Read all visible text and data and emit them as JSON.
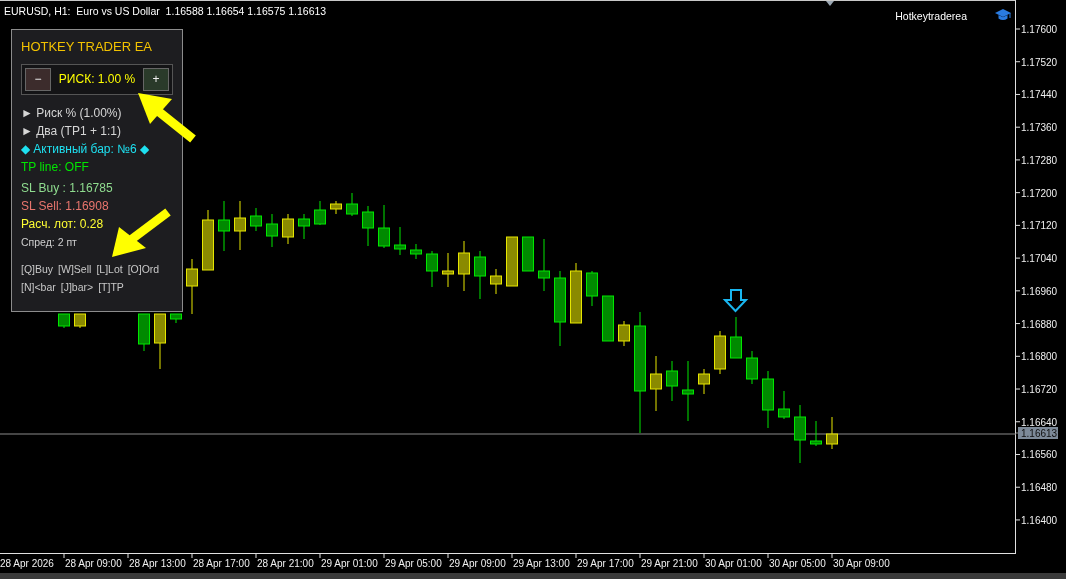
{
  "header": "EURUSD, H1:  Euro vs US Dollar  1.16588 1.16654 1.16575 1.16613",
  "chart_label": "Hotkeytraderea",
  "panel": {
    "title": "HOTKEY TRADER EA",
    "minus": "−",
    "risk": "РИСК: 1.00 %",
    "plus": "+",
    "lines": [
      {
        "text": "► Риск % (1.00%)",
        "color": "#d6d6d6"
      },
      {
        "text": "► Два (TP1 + 1:1)",
        "color": "#d6d6d6"
      },
      {
        "text": "◆ Активный бар: №6 ◆",
        "color": "#1ee0f0"
      },
      {
        "text": "TP line: OFF",
        "color": "#00e600"
      },
      {
        "text": "SL Buy : 1.16785",
        "color": "#8fdc8f"
      },
      {
        "text": "SL Sell: 1.16908",
        "color": "#e8756d"
      },
      {
        "text": "Расч. лот: 0.28",
        "color": "#ffff33"
      }
    ],
    "spread": "Спред: 2 пт",
    "hotkeys": [
      [
        "[Q]Buy",
        "[W]Sell",
        "[L]Lot",
        "[O]Ord"
      ],
      [
        "[N]<bar",
        "[J]bar>",
        "[T]TP"
      ]
    ]
  },
  "price_axis": [
    "1.17600",
    "1.17520",
    "1.17440",
    "1.17360",
    "1.17280",
    "1.17200",
    "1.17120",
    "1.17040",
    "1.16960",
    "1.16880",
    "1.16800",
    "1.16720",
    "1.16640",
    "1.16560",
    "1.16480",
    "1.16400"
  ],
  "current_price": "1.16613",
  "time_axis": [
    "28 Apr 2026",
    "28 Apr 09:00",
    "28 Apr 13:00",
    "28 Apr 17:00",
    "28 Apr 21:00",
    "29 Apr 01:00",
    "29 Apr 05:00",
    "29 Apr 09:00",
    "29 Apr 13:00",
    "29 Apr 17:00",
    "29 Apr 21:00",
    "30 Apr 01:00",
    "30 Apr 05:00",
    "30 Apr 09:00"
  ]
}
